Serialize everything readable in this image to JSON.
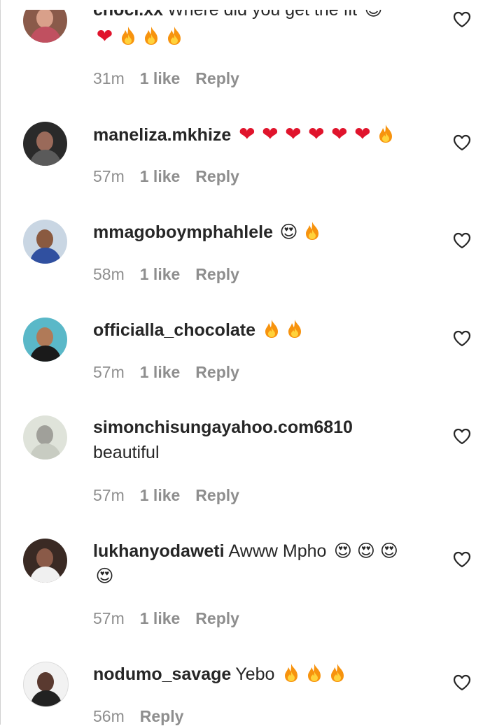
{
  "comments": [
    {
      "username": "choci.xx",
      "text": "Where did you get the fit",
      "emoji_line1": [
        "smile"
      ],
      "emoji_line2": [
        "heart",
        "fire",
        "fire",
        "fire"
      ],
      "time": "31m",
      "likes": "1 like",
      "reply": "Reply"
    },
    {
      "username": "maneliza.mkhize",
      "text": "",
      "emoji_line1": [
        "heart",
        "heart",
        "heart",
        "heart",
        "heart",
        "heart",
        "fire"
      ],
      "time": "57m",
      "likes": "1 like",
      "reply": "Reply"
    },
    {
      "username": "mmagoboymphahlele",
      "text": "",
      "emoji_line1": [
        "heart-eyes",
        "fire"
      ],
      "time": "58m",
      "likes": "1 like",
      "reply": "Reply"
    },
    {
      "username": "officialla_chocolate",
      "text": "",
      "emoji_line1": [
        "fire",
        "fire"
      ],
      "time": "57m",
      "likes": "1 like",
      "reply": "Reply"
    },
    {
      "username": "simonchisungayahoo.com6810",
      "text": "beautiful",
      "time": "57m",
      "likes": "1 like",
      "reply": "Reply"
    },
    {
      "username": "lukhanyodaweti",
      "text": "Awww Mpho",
      "emoji_line1": [
        "heart-eyes",
        "heart-eyes",
        "heart-eyes"
      ],
      "emoji_line2": [
        "heart-eyes"
      ],
      "time": "57m",
      "likes": "1 like",
      "reply": "Reply"
    },
    {
      "username": "nodumo_savage",
      "text": "Yebo",
      "emoji_line1": [
        "fire",
        "fire",
        "fire"
      ],
      "time": "56m",
      "reply": "Reply"
    }
  ],
  "colors": {
    "text": "#262626",
    "meta": "#8e8e8e",
    "heart": "#e0142c",
    "fire_outer": "#f7930e",
    "fire_inner": "#ffd23b"
  }
}
